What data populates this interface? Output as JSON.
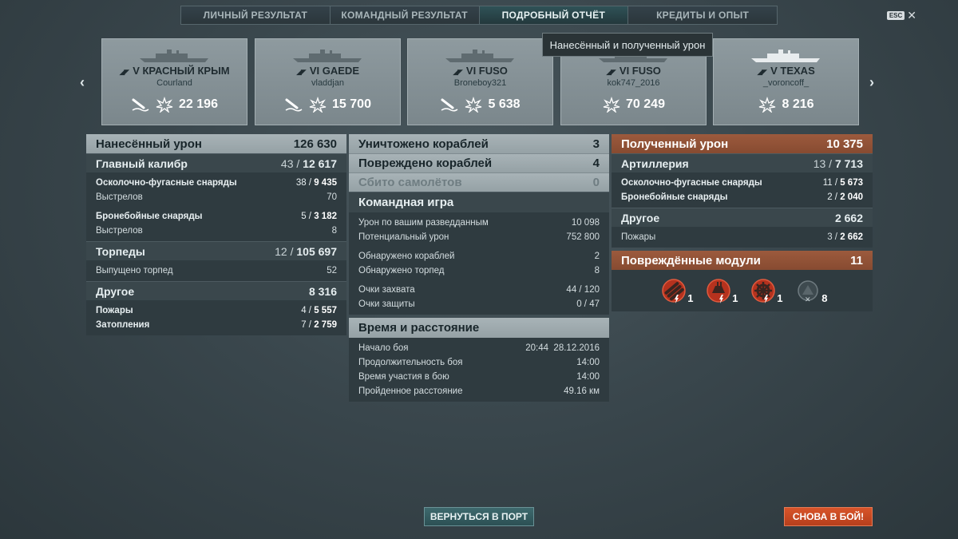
{
  "tabs": [
    {
      "label": "ЛИЧНЫЙ РЕЗУЛЬТАТ"
    },
    {
      "label": "КОМАНДНЫЙ РЕЗУЛЬТАТ"
    },
    {
      "label": "ПОДРОБНЫЙ ОТЧЁТ"
    },
    {
      "label": "КРЕДИТЫ И ОПЫТ"
    }
  ],
  "esc_label": "ESC",
  "tooltip": "Нанесённый и полученный урон",
  "ships": [
    {
      "name": "V КРАСНЫЙ КРЫМ",
      "player": "Courland",
      "damage": "22 196"
    },
    {
      "name": "VI GAEDE",
      "player": "vladdjan",
      "damage": "15 700"
    },
    {
      "name": "VI FUSO",
      "player": "Broneboy321",
      "damage": "5 638"
    },
    {
      "name": "VI FUSO",
      "player": "kok747_2016",
      "damage": "70 249"
    },
    {
      "name": "V TEXAS",
      "player": "_voroncoff_",
      "damage": "8 216"
    }
  ],
  "dealt": {
    "title": "Нанесённый урон",
    "total": "126 630",
    "main": {
      "label": "Главный калибр",
      "hits": "43 /",
      "value": "12 617"
    },
    "he": {
      "label": "Осколочно-фугасные снаряды",
      "hits": "38 /",
      "value": "9 435"
    },
    "he_shots": {
      "label": "Выстрелов",
      "value": "70"
    },
    "ap": {
      "label": "Бронебойные снаряды",
      "hits": "5 /",
      "value": "3 182"
    },
    "ap_shots": {
      "label": "Выстрелов",
      "value": "8"
    },
    "torp": {
      "label": "Торпеды",
      "hits": "12 /",
      "value": "105 697"
    },
    "torp_launched": {
      "label": "Выпущено торпед",
      "value": "52"
    },
    "other": {
      "label": "Другое",
      "value": "8 316"
    },
    "fires": {
      "label": "Пожары",
      "hits": "4 /",
      "value": "5 557"
    },
    "floods": {
      "label": "Затопления",
      "hits": "7 /",
      "value": "2 759"
    }
  },
  "middle": {
    "destroyed": {
      "label": "Уничтожено кораблей",
      "value": "3"
    },
    "damaged": {
      "label": "Повреждено кораблей",
      "value": "4"
    },
    "planes": {
      "label": "Сбито самолётов",
      "value": "0"
    },
    "team": {
      "title": "Командная игра"
    },
    "spotting_dmg": {
      "label": "Урон по вашим разведданным",
      "value": "10 098"
    },
    "potential": {
      "label": "Потенциальный урон",
      "value": "752 800"
    },
    "spotted_ships": {
      "label": "Обнаружено кораблей",
      "value": "2"
    },
    "spotted_torps": {
      "label": "Обнаружено торпед",
      "value": "8"
    },
    "capture": {
      "label": "Очки захвата",
      "value": "44 / 120"
    },
    "defense": {
      "label": "Очки защиты",
      "value": "0 / 47"
    },
    "time": {
      "title": "Время и расстояние"
    },
    "start": {
      "label": "Начало боя",
      "value": "20:44  28.12.2016"
    },
    "duration": {
      "label": "Продолжительность боя",
      "value": "14:00"
    },
    "participation": {
      "label": "Время участия в бою",
      "value": "14:00"
    },
    "distance": {
      "label": "Пройденное расстояние",
      "value": "49.16 км"
    }
  },
  "received": {
    "title": "Полученный урон",
    "total": "10 375",
    "artillery": {
      "label": "Артиллерия",
      "hits": "13 /",
      "value": "7 713"
    },
    "he": {
      "label": "Осколочно-фугасные снаряды",
      "hits": "11 /",
      "value": "5 673"
    },
    "ap": {
      "label": "Бронебойные снаряды",
      "hits": "2 /",
      "value": "2 040"
    },
    "other": {
      "label": "Другое",
      "value": "2 662"
    },
    "fires": {
      "label": "Пожары",
      "hits": "3 /",
      "value": "2 662"
    },
    "modules": {
      "title": "Повреждённые модули",
      "value": "11"
    },
    "module_counts": [
      "1",
      "1",
      "1",
      "8"
    ]
  },
  "buttons": {
    "port": "ВЕРНУТЬСЯ В ПОРТ",
    "battle": "СНОВА В БОЙ!"
  }
}
